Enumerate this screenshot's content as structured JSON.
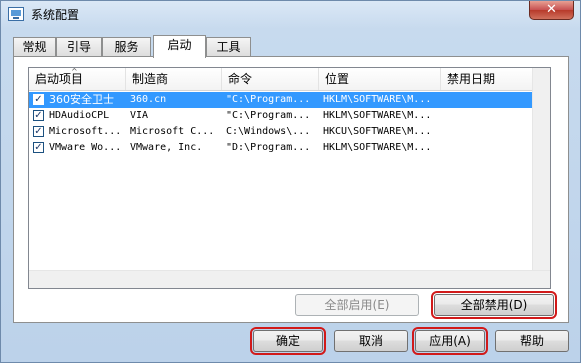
{
  "window": {
    "title": "系统配置",
    "close_label": "✕"
  },
  "tabs": [
    {
      "label": "常规"
    },
    {
      "label": "引导"
    },
    {
      "label": "服务"
    },
    {
      "label": "启动"
    },
    {
      "label": "工具"
    }
  ],
  "active_tab": "启动",
  "list": {
    "columns": [
      "启动项目",
      "制造商",
      "命令",
      "位置",
      "禁用日期"
    ],
    "sort_arrow": "^",
    "rows": [
      {
        "item": "360安全卫士",
        "maker": "360.cn",
        "command": "\"C:\\Program...",
        "location": "HKLM\\SOFTWARE\\M...",
        "date": "",
        "checked": true,
        "selected": true
      },
      {
        "item": "HDAudioCPL",
        "maker": "VIA",
        "command": "\"C:\\Program...",
        "location": "HKLM\\SOFTWARE\\M...",
        "date": "",
        "checked": true,
        "selected": false
      },
      {
        "item": "Microsoft...",
        "maker": "Microsoft C...",
        "command": "C:\\Windows\\...",
        "location": "HKCU\\SOFTWARE\\M...",
        "date": "",
        "checked": true,
        "selected": false
      },
      {
        "item": "VMware Wo...",
        "maker": "VMware, Inc.",
        "command": "\"D:\\Program...",
        "location": "HKLM\\SOFTWARE\\M...",
        "date": "",
        "checked": true,
        "selected": false
      }
    ],
    "check_mark": "✓"
  },
  "buttons": {
    "enable_all": "全部启用(E)",
    "disable_all": "全部禁用(D)",
    "ok": "确定",
    "cancel": "取消",
    "apply": "应用(A)",
    "help": "帮助"
  },
  "colors": {
    "selection": "#3399ff",
    "highlight_box": "#d11a1a"
  }
}
